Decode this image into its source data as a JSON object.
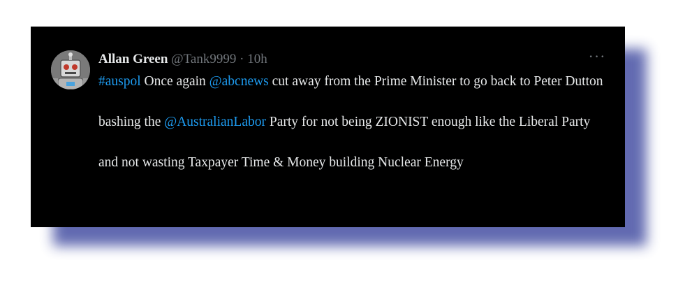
{
  "tweet": {
    "display_name": "Allan Green",
    "handle": "@Tank9999",
    "separator": "·",
    "time": "10h",
    "more_icon": "more-horizontal-icon",
    "more_glyph": "···",
    "body": {
      "p1": {
        "hashtag": "#auspol",
        "t1": " Once again ",
        "mention": "@abcnews",
        "t2": " cut away from the Prime Minister to go back to Peter Dutton"
      },
      "p2": {
        "t1": "bashing the ",
        "mention": "@AustralianLabor",
        "t2": " Party for not being ZIONIST enough like the Liberal Party"
      },
      "p3": {
        "t1": "and not wasting Taxpayer Time & Money building Nuclear Energy"
      }
    }
  },
  "colors": {
    "card_background": "#000000",
    "text_primary": "#e7e9ea",
    "text_secondary": "#71767b",
    "link": "#1d9bf0",
    "shadow": "#5a63ad"
  }
}
